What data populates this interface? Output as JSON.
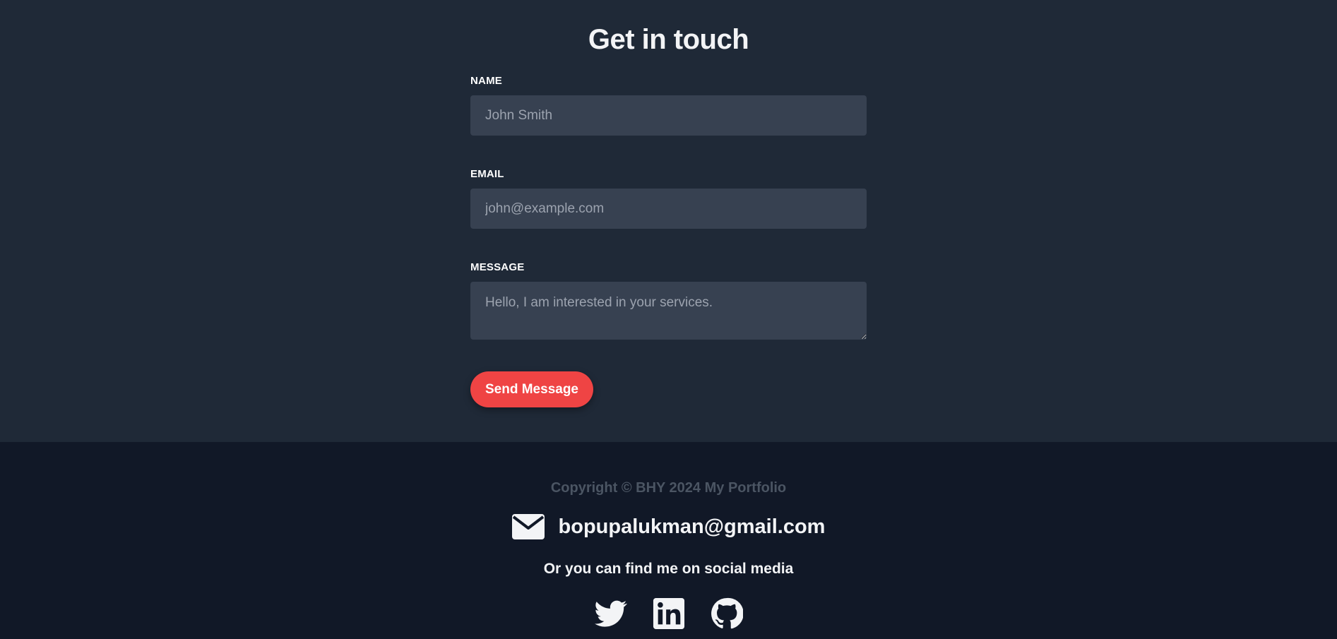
{
  "contact": {
    "title": "Get in touch",
    "name_label": "NAME",
    "name_placeholder": "John Smith",
    "email_label": "EMAIL",
    "email_placeholder": "john@example.com",
    "message_label": "MESSAGE",
    "message_placeholder": "Hello, I am interested in your services.",
    "send_label": "Send Message"
  },
  "footer": {
    "copyright": "Copyright © BHY 2024 My Portfolio",
    "email": "bopupalukman@gmail.com",
    "social_text": "Or you can find me on social media",
    "icons": [
      "envelope-icon",
      "twitter-icon",
      "linkedin-icon",
      "github-icon"
    ]
  },
  "colors": {
    "background": "#1f2937",
    "footer_background": "#111827",
    "field_background": "#374151",
    "accent": "#ef4444",
    "muted_text": "#4b5563"
  }
}
